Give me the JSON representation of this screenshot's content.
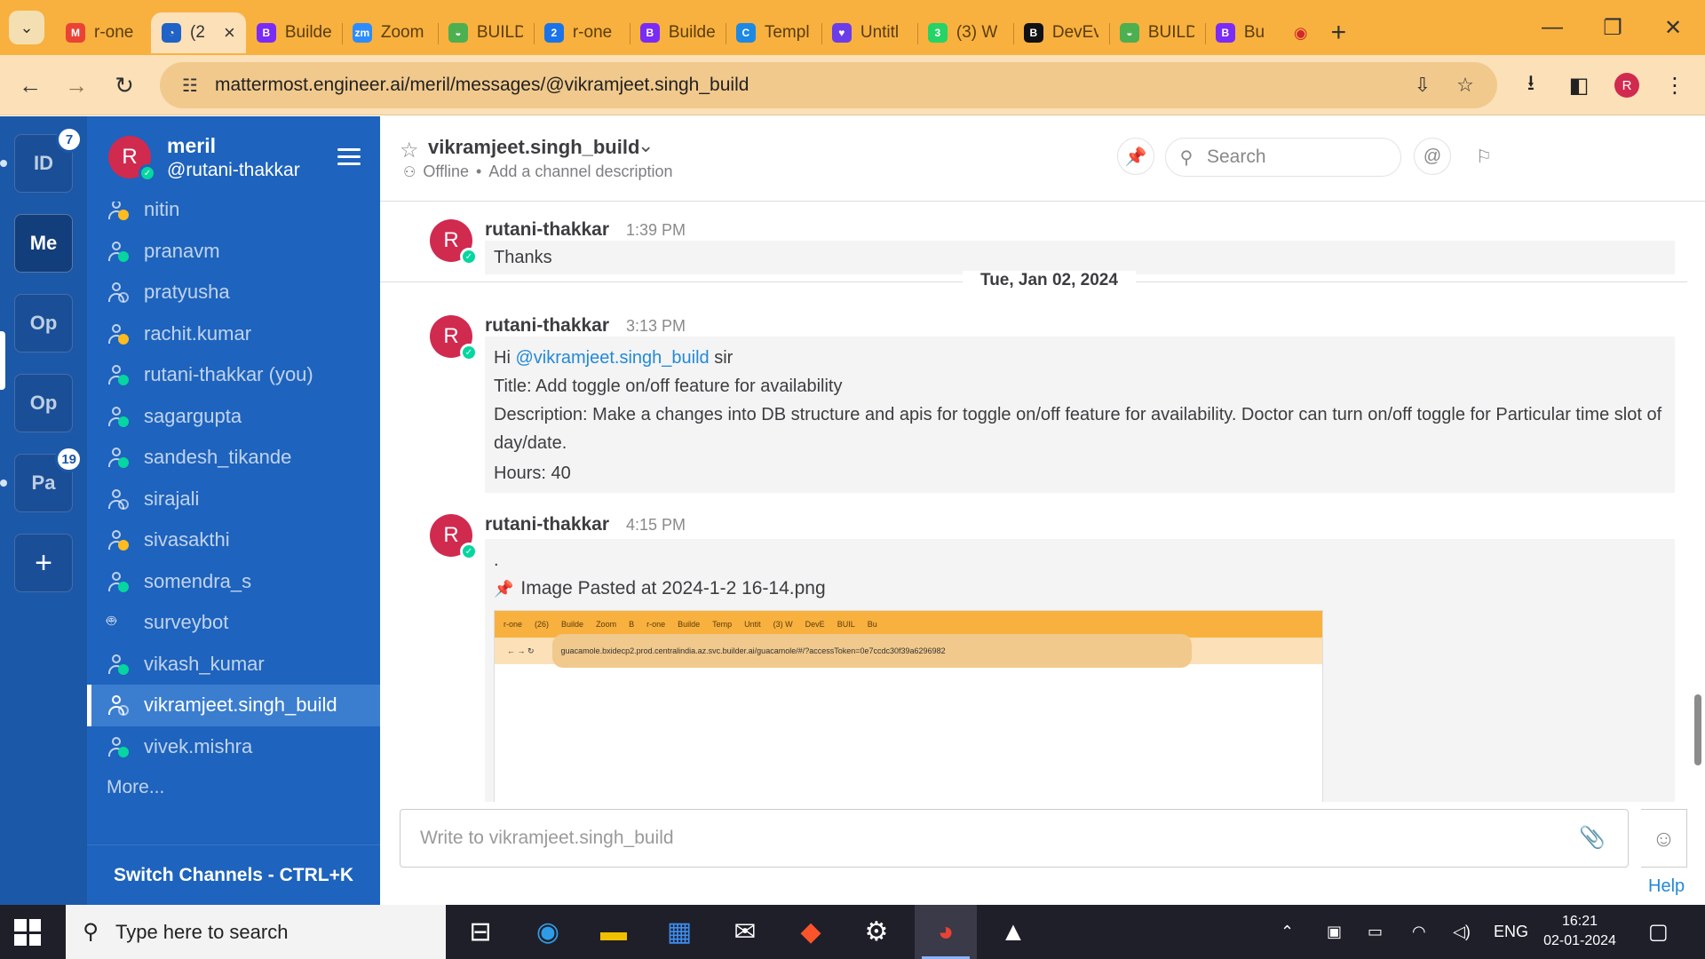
{
  "browser": {
    "tabs": [
      {
        "label": "r-one",
        "fav_color": "#ea4335",
        "fav_text": "M"
      },
      {
        "label": "(2",
        "fav_color": "#2062c5",
        "fav_text": "◔",
        "active": true
      },
      {
        "label": "Builde",
        "fav_color": "#7a2bf5",
        "fav_text": "B"
      },
      {
        "label": "Zoom",
        "fav_color": "#2d8cff",
        "fav_text": "zm"
      },
      {
        "label": "BUILD",
        "fav_color": "#4caf50",
        "fav_text": "◒"
      },
      {
        "label": "r-one",
        "fav_color": "#1a73e8",
        "fav_text": "2"
      },
      {
        "label": "Builde",
        "fav_color": "#7a2bf5",
        "fav_text": "B"
      },
      {
        "label": "Templ",
        "fav_color": "#1e88e5",
        "fav_text": "C"
      },
      {
        "label": "Untitl",
        "fav_color": "#6a3de8",
        "fav_text": "♥"
      },
      {
        "label": "(3) W",
        "fav_color": "#25d366",
        "fav_text": "3"
      },
      {
        "label": "DevEv",
        "fav_color": "#111111",
        "fav_text": "B"
      },
      {
        "label": "BUILD",
        "fav_color": "#4caf50",
        "fav_text": "◒"
      },
      {
        "label": "Bu",
        "fav_color": "#7a2bf5",
        "fav_text": "B"
      }
    ],
    "active_tab_close": "×",
    "new_tab": "+",
    "url": "mattermost.engineer.ai/meril/messages/@vikramjeet.singh_build",
    "profile_initial": "R"
  },
  "teams": [
    {
      "label": "ID",
      "badge": "7",
      "dot": true
    },
    {
      "label": "Me",
      "active": true
    },
    {
      "label": "Op"
    },
    {
      "label": "Op"
    },
    {
      "label": "Pa",
      "badge": "19",
      "dot": true
    }
  ],
  "team_add": "+",
  "sidebar": {
    "display_name": "meril",
    "username": "@rutani-thakkar",
    "avatar_initial": "R",
    "channels": [
      {
        "label": "nitin",
        "status": "away"
      },
      {
        "label": "pranavm",
        "status": "online"
      },
      {
        "label": "pratyusha",
        "status": "offline"
      },
      {
        "label": "rachit.kumar",
        "status": "away"
      },
      {
        "label": "rutani-thakkar (you)",
        "status": "online"
      },
      {
        "label": "sagargupta",
        "status": "online"
      },
      {
        "label": "sandesh_tikande",
        "status": "online"
      },
      {
        "label": "sirajali",
        "status": "offline"
      },
      {
        "label": "sivasakthi",
        "status": "away"
      },
      {
        "label": "somendra_s",
        "status": "online"
      },
      {
        "label": "surveybot",
        "status": "bot"
      },
      {
        "label": "vikash_kumar",
        "status": "online"
      },
      {
        "label": "vikramjeet.singh_build",
        "status": "offline",
        "active": true
      },
      {
        "label": "vivek.mishra",
        "status": "online"
      }
    ],
    "more_label": "More...",
    "switch_label": "Switch Channels - CTRL+K"
  },
  "channel": {
    "title": "vikramjeet.singh_build",
    "status": "Offline",
    "separator": "•",
    "description": "Add a channel description",
    "search_placeholder": "Search"
  },
  "posts": [
    {
      "author": "rutani-thakkar",
      "time": "1:39 PM",
      "avatar": "R",
      "lines": [
        "Thanks"
      ]
    },
    {
      "author": "rutani-thakkar",
      "time": "3:13 PM",
      "avatar": "R",
      "greeting_prefix": "Hi ",
      "mention": "@vikramjeet.singh_build",
      "greeting_suffix": " sir",
      "title_line": "Title:  Add toggle on/off feature for availability",
      "description_line": "Description: Make a changes into DB structure and apis for toggle on/off feature for availability. Doctor can turn on/off toggle for Particular time slot of day/date.",
      "hours_line": "Hours: 40"
    },
    {
      "author": "rutani-thakkar",
      "time": "4:15 PM",
      "avatar": "R",
      "text": ".",
      "attachment": "Image Pasted at 2024-1-2 16-14.png",
      "preview_url": "guacamole.bxidecp2.prod.centralindia.az.svc.builder.ai/guacamole/#/?accessToken=0e7ccdc30f39a6296982",
      "preview_tabs": [
        "r-one",
        "(26)",
        "Builde",
        "Zoom",
        "B",
        "r-one",
        "Builde",
        "Temp",
        "Untit",
        "(3) W",
        "DevE",
        "BUIL",
        "Bu"
      ]
    }
  ],
  "date_separator": "Tue, Jan 02, 2024",
  "composer_placeholder": "Write to vikramjeet.singh_build",
  "help_label": "Help",
  "taskbar": {
    "search_placeholder": "Type here to search",
    "lang": "ENG",
    "time": "16:21",
    "date": "02-01-2024"
  }
}
